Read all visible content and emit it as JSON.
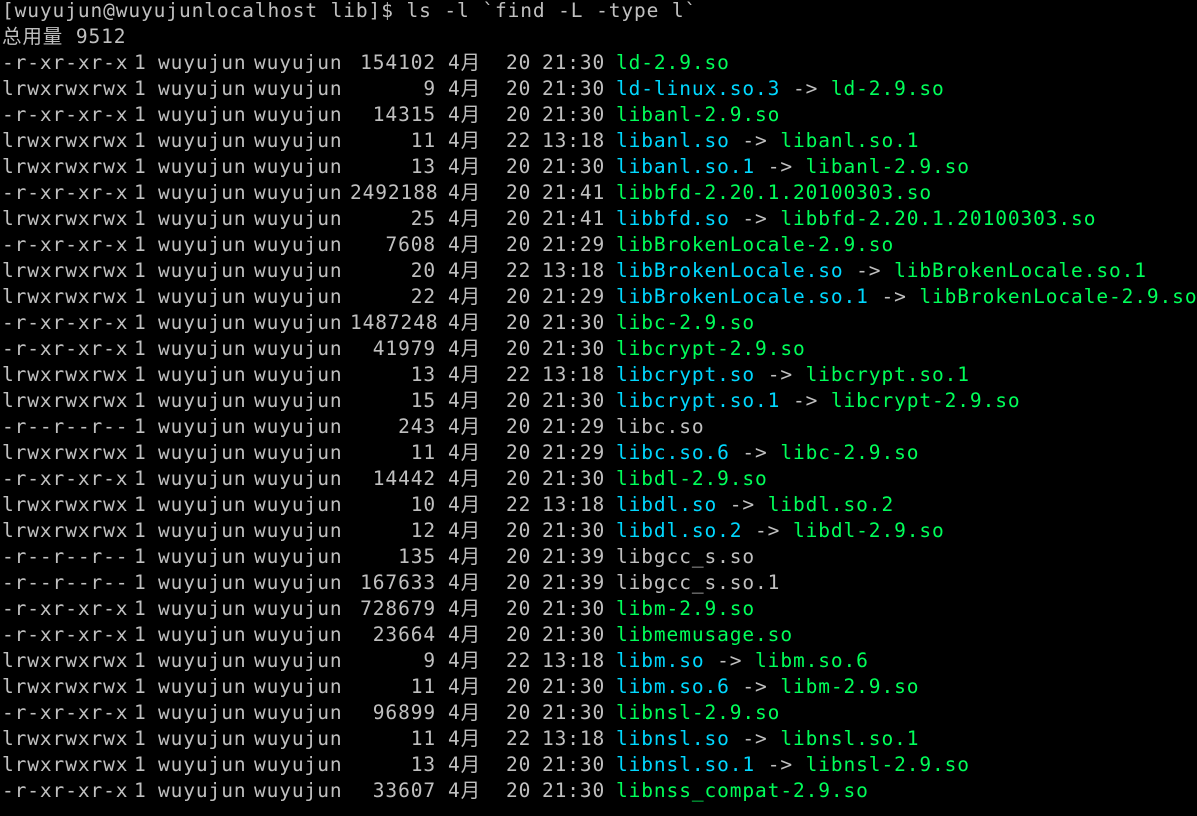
{
  "prompt": "[wuyujun@wuyujunlocalhost lib]$ ls -l `find -L -type l`",
  "total": "总用量 9512",
  "colors": {
    "background": "#000000",
    "text": "#c0c0c0",
    "regular_file": "#00ff5a",
    "symlink": "#00d8ff"
  },
  "files": [
    {
      "perm": "-r-xr-xr-x",
      "links": "1",
      "user": "wuyujun",
      "group": "wuyujun",
      "size": "154102",
      "month": "4月",
      "day": "20",
      "time": "21:30",
      "name": "ld-2.9.so",
      "type": "file",
      "arrow": "",
      "target": ""
    },
    {
      "perm": "lrwxrwxrwx",
      "links": "1",
      "user": "wuyujun",
      "group": "wuyujun",
      "size": "9",
      "month": "4月",
      "day": "20",
      "time": "21:30",
      "name": "ld-linux.so.3",
      "type": "link",
      "arrow": "->",
      "target": "ld-2.9.so"
    },
    {
      "perm": "-r-xr-xr-x",
      "links": "1",
      "user": "wuyujun",
      "group": "wuyujun",
      "size": "14315",
      "month": "4月",
      "day": "20",
      "time": "21:30",
      "name": "libanl-2.9.so",
      "type": "file",
      "arrow": "",
      "target": ""
    },
    {
      "perm": "lrwxrwxrwx",
      "links": "1",
      "user": "wuyujun",
      "group": "wuyujun",
      "size": "11",
      "month": "4月",
      "day": "22",
      "time": "13:18",
      "name": "libanl.so",
      "type": "link",
      "arrow": "->",
      "target": "libanl.so.1"
    },
    {
      "perm": "lrwxrwxrwx",
      "links": "1",
      "user": "wuyujun",
      "group": "wuyujun",
      "size": "13",
      "month": "4月",
      "day": "20",
      "time": "21:30",
      "name": "libanl.so.1",
      "type": "link",
      "arrow": "->",
      "target": "libanl-2.9.so"
    },
    {
      "perm": "-r-xr-xr-x",
      "links": "1",
      "user": "wuyujun",
      "group": "wuyujun",
      "size": "2492188",
      "month": "4月",
      "day": "20",
      "time": "21:41",
      "name": "libbfd-2.20.1.20100303.so",
      "type": "file",
      "arrow": "",
      "target": ""
    },
    {
      "perm": "lrwxrwxrwx",
      "links": "1",
      "user": "wuyujun",
      "group": "wuyujun",
      "size": "25",
      "month": "4月",
      "day": "20",
      "time": "21:41",
      "name": "libbfd.so",
      "type": "link",
      "arrow": "->",
      "target": "libbfd-2.20.1.20100303.so"
    },
    {
      "perm": "-r-xr-xr-x",
      "links": "1",
      "user": "wuyujun",
      "group": "wuyujun",
      "size": "7608",
      "month": "4月",
      "day": "20",
      "time": "21:29",
      "name": "libBrokenLocale-2.9.so",
      "type": "file",
      "arrow": "",
      "target": ""
    },
    {
      "perm": "lrwxrwxrwx",
      "links": "1",
      "user": "wuyujun",
      "group": "wuyujun",
      "size": "20",
      "month": "4月",
      "day": "22",
      "time": "13:18",
      "name": "libBrokenLocale.so",
      "type": "link",
      "arrow": "->",
      "target": "libBrokenLocale.so.1"
    },
    {
      "perm": "lrwxrwxrwx",
      "links": "1",
      "user": "wuyujun",
      "group": "wuyujun",
      "size": "22",
      "month": "4月",
      "day": "20",
      "time": "21:29",
      "name": "libBrokenLocale.so.1",
      "type": "link",
      "arrow": "->",
      "target": "libBrokenLocale-2.9.so"
    },
    {
      "perm": "-r-xr-xr-x",
      "links": "1",
      "user": "wuyujun",
      "group": "wuyujun",
      "size": "1487248",
      "month": "4月",
      "day": "20",
      "time": "21:30",
      "name": "libc-2.9.so",
      "type": "file",
      "arrow": "",
      "target": ""
    },
    {
      "perm": "-r-xr-xr-x",
      "links": "1",
      "user": "wuyujun",
      "group": "wuyujun",
      "size": "41979",
      "month": "4月",
      "day": "20",
      "time": "21:30",
      "name": "libcrypt-2.9.so",
      "type": "file",
      "arrow": "",
      "target": ""
    },
    {
      "perm": "lrwxrwxrwx",
      "links": "1",
      "user": "wuyujun",
      "group": "wuyujun",
      "size": "13",
      "month": "4月",
      "day": "22",
      "time": "13:18",
      "name": "libcrypt.so",
      "type": "link",
      "arrow": "->",
      "target": "libcrypt.so.1"
    },
    {
      "perm": "lrwxrwxrwx",
      "links": "1",
      "user": "wuyujun",
      "group": "wuyujun",
      "size": "15",
      "month": "4月",
      "day": "20",
      "time": "21:30",
      "name": "libcrypt.so.1",
      "type": "link",
      "arrow": "->",
      "target": "libcrypt-2.9.so"
    },
    {
      "perm": "-r--r--r--",
      "links": "1",
      "user": "wuyujun",
      "group": "wuyujun",
      "size": "243",
      "month": "4月",
      "day": "20",
      "time": "21:29",
      "name": "libc.so",
      "type": "plain",
      "arrow": "",
      "target": ""
    },
    {
      "perm": "lrwxrwxrwx",
      "links": "1",
      "user": "wuyujun",
      "group": "wuyujun",
      "size": "11",
      "month": "4月",
      "day": "20",
      "time": "21:29",
      "name": "libc.so.6",
      "type": "link",
      "arrow": "->",
      "target": "libc-2.9.so"
    },
    {
      "perm": "-r-xr-xr-x",
      "links": "1",
      "user": "wuyujun",
      "group": "wuyujun",
      "size": "14442",
      "month": "4月",
      "day": "20",
      "time": "21:30",
      "name": "libdl-2.9.so",
      "type": "file",
      "arrow": "",
      "target": ""
    },
    {
      "perm": "lrwxrwxrwx",
      "links": "1",
      "user": "wuyujun",
      "group": "wuyujun",
      "size": "10",
      "month": "4月",
      "day": "22",
      "time": "13:18",
      "name": "libdl.so",
      "type": "link",
      "arrow": "->",
      "target": "libdl.so.2"
    },
    {
      "perm": "lrwxrwxrwx",
      "links": "1",
      "user": "wuyujun",
      "group": "wuyujun",
      "size": "12",
      "month": "4月",
      "day": "20",
      "time": "21:30",
      "name": "libdl.so.2",
      "type": "link",
      "arrow": "->",
      "target": "libdl-2.9.so"
    },
    {
      "perm": "-r--r--r--",
      "links": "1",
      "user": "wuyujun",
      "group": "wuyujun",
      "size": "135",
      "month": "4月",
      "day": "20",
      "time": "21:39",
      "name": "libgcc_s.so",
      "type": "plain",
      "arrow": "",
      "target": ""
    },
    {
      "perm": "-r--r--r--",
      "links": "1",
      "user": "wuyujun",
      "group": "wuyujun",
      "size": "167633",
      "month": "4月",
      "day": "20",
      "time": "21:39",
      "name": "libgcc_s.so.1",
      "type": "plain",
      "arrow": "",
      "target": ""
    },
    {
      "perm": "-r-xr-xr-x",
      "links": "1",
      "user": "wuyujun",
      "group": "wuyujun",
      "size": "728679",
      "month": "4月",
      "day": "20",
      "time": "21:30",
      "name": "libm-2.9.so",
      "type": "file",
      "arrow": "",
      "target": ""
    },
    {
      "perm": "-r-xr-xr-x",
      "links": "1",
      "user": "wuyujun",
      "group": "wuyujun",
      "size": "23664",
      "month": "4月",
      "day": "20",
      "time": "21:30",
      "name": "libmemusage.so",
      "type": "file",
      "arrow": "",
      "target": ""
    },
    {
      "perm": "lrwxrwxrwx",
      "links": "1",
      "user": "wuyujun",
      "group": "wuyujun",
      "size": "9",
      "month": "4月",
      "day": "22",
      "time": "13:18",
      "name": "libm.so",
      "type": "link",
      "arrow": "->",
      "target": "libm.so.6"
    },
    {
      "perm": "lrwxrwxrwx",
      "links": "1",
      "user": "wuyujun",
      "group": "wuyujun",
      "size": "11",
      "month": "4月",
      "day": "20",
      "time": "21:30",
      "name": "libm.so.6",
      "type": "link",
      "arrow": "->",
      "target": "libm-2.9.so"
    },
    {
      "perm": "-r-xr-xr-x",
      "links": "1",
      "user": "wuyujun",
      "group": "wuyujun",
      "size": "96899",
      "month": "4月",
      "day": "20",
      "time": "21:30",
      "name": "libnsl-2.9.so",
      "type": "file",
      "arrow": "",
      "target": ""
    },
    {
      "perm": "lrwxrwxrwx",
      "links": "1",
      "user": "wuyujun",
      "group": "wuyujun",
      "size": "11",
      "month": "4月",
      "day": "22",
      "time": "13:18",
      "name": "libnsl.so",
      "type": "link",
      "arrow": "->",
      "target": "libnsl.so.1"
    },
    {
      "perm": "lrwxrwxrwx",
      "links": "1",
      "user": "wuyujun",
      "group": "wuyujun",
      "size": "13",
      "month": "4月",
      "day": "20",
      "time": "21:30",
      "name": "libnsl.so.1",
      "type": "link",
      "arrow": "->",
      "target": "libnsl-2.9.so"
    },
    {
      "perm": "-r-xr-xr-x",
      "links": "1",
      "user": "wuyujun",
      "group": "wuyujun",
      "size": "33607",
      "month": "4月",
      "day": "20",
      "time": "21:30",
      "name": "libnss_compat-2.9.so",
      "type": "file",
      "arrow": "",
      "target": ""
    }
  ]
}
